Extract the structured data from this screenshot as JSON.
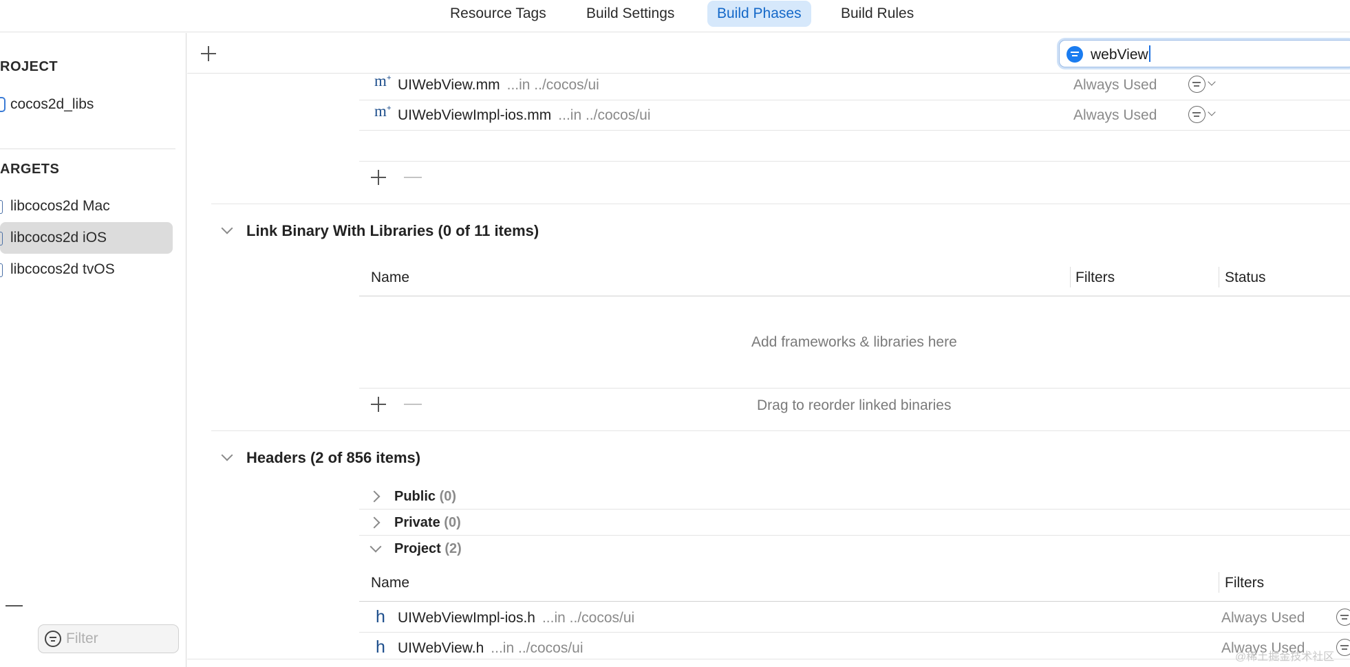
{
  "tabs": [
    {
      "label": "Resource Tags"
    },
    {
      "label": "Build Settings"
    },
    {
      "label": "Build Phases"
    },
    {
      "label": "Build Rules"
    }
  ],
  "sidebar": {
    "project_heading": "ROJECT",
    "project_item": "cocos2d_libs",
    "targets_heading": "ARGETS",
    "targets": [
      {
        "label": "libcocos2d Mac"
      },
      {
        "label": "libcocos2d iOS"
      },
      {
        "label": "libcocos2d tvOS"
      }
    ],
    "filter_placeholder": "Filter"
  },
  "search": {
    "value": "webView"
  },
  "compile_sources_rows": [
    {
      "name": "UIWebView.mm",
      "path": "...in ../cocos/ui",
      "usage": "Always Used"
    },
    {
      "name": "UIWebViewImpl-ios.mm",
      "path": "...in ../cocos/ui",
      "usage": "Always Used"
    }
  ],
  "link_binary": {
    "title": "Link Binary With Libraries (0 of 11 items)",
    "col_name": "Name",
    "col_filters": "Filters",
    "col_status": "Status",
    "empty_msg": "Add frameworks & libraries here",
    "drag_msg": "Drag to reorder linked binaries"
  },
  "headers": {
    "title": "Headers (2 of 856 items)",
    "groups": [
      {
        "label": "Public",
        "count": "(0)"
      },
      {
        "label": "Private",
        "count": "(0)"
      },
      {
        "label": "Project",
        "count": "(2)"
      }
    ],
    "col_name": "Name",
    "col_filters": "Filters",
    "rows": [
      {
        "name": "UIWebViewImpl-ios.h",
        "path": "...in ../cocos/ui",
        "usage": "Always Used"
      },
      {
        "name": "UIWebView.h",
        "path": "...in ../cocos/ui",
        "usage": "Always Used"
      }
    ]
  },
  "watermark": "@稀土掘金技术社区",
  "colors": {
    "accent": "#1a7cf0",
    "active_tab_bg": "#d6e8fb",
    "selected_row_bg": "#dcdcdc"
  }
}
